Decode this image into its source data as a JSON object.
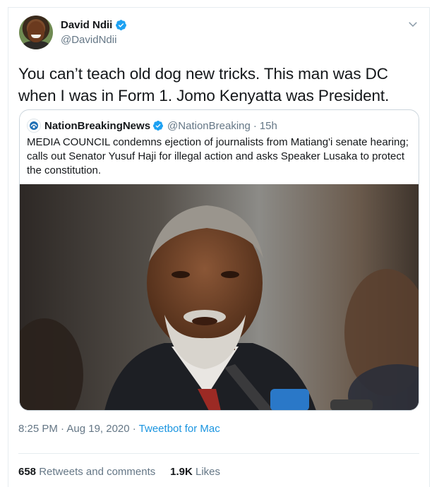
{
  "author": {
    "display_name": "David Ndii",
    "handle": "@DavidNdii",
    "verified": true
  },
  "tweet": {
    "text": "You can’t teach old dog new tricks. This man was DC when I was in Form 1. Jomo Kenyatta was President.",
    "timestamp": "8:25 PM · Aug 19, 2020 · ",
    "source": "Tweetbot for Mac"
  },
  "quoted_tweet": {
    "display_name": "NationBreakingNews",
    "handle": "@NationBreaking",
    "separator": "·",
    "time_ago": "15h",
    "text": "MEDIA COUNCIL condemns ejection of journalists from Matiang'i senate hearing; calls out Senator Yusuf Haji for illegal action and asks Speaker Lusaka to protect the constitution."
  },
  "stats": {
    "retweets_count": "658",
    "retweets_label": "Retweets and comments",
    "likes_count": "1.9K",
    "likes_label": "Likes"
  },
  "icons": {
    "verified": "verified-badge-icon",
    "caret": "chevron-down-icon"
  },
  "colors": {
    "verified_blue": "#1da1f2",
    "link_blue": "#1b95e0",
    "secondary_text": "#657786"
  }
}
